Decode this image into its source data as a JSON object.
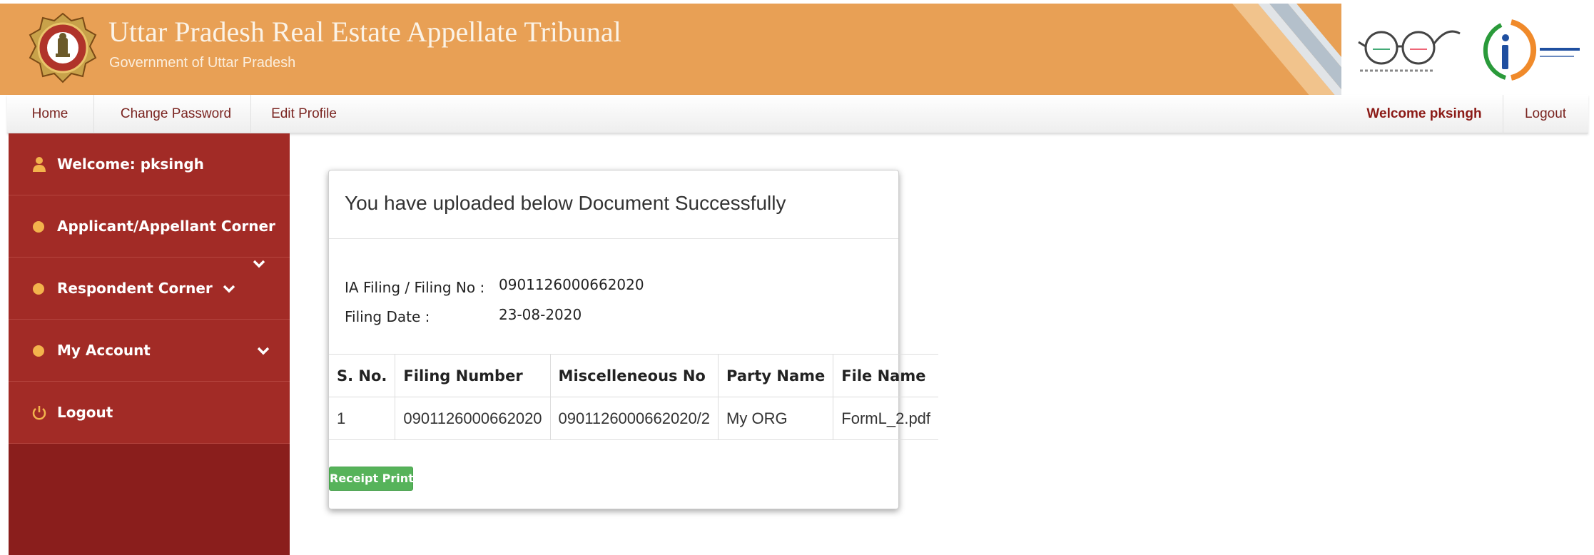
{
  "header": {
    "title": "Uttar Pradesh Real Estate Appellate Tribunal",
    "subtitle": "Government of Uttar Pradesh",
    "emblem_icon": "state-emblem-icon",
    "logos": [
      "swachh-bharat-logo",
      "digital-india-logo"
    ],
    "banner_color": "#e8a055"
  },
  "topnav": {
    "home": "Home",
    "change_password": "Change Password",
    "edit_profile": "Edit Profile",
    "welcome": "Welcome pksingh",
    "logout": "Logout"
  },
  "sidebar": {
    "items": [
      {
        "label": "Welcome: pksingh",
        "icon": "user-icon"
      },
      {
        "label": "Applicant/Appellant Corner",
        "icon": "circle-icon"
      },
      {
        "label": "Respondent Corner",
        "icon": "circle-icon"
      },
      {
        "label": "My Account",
        "icon": "circle-icon"
      },
      {
        "label": "Logout",
        "icon": "power-icon"
      }
    ],
    "color": "#a22b26"
  },
  "card": {
    "title": "You have uploaded below Document Successfully",
    "filing_no_label": "IA Filing / Filing No :",
    "filing_no_value": "0901126000662020",
    "filing_date_label": "Filing Date :",
    "filing_date_value": "23-08-2020",
    "table": {
      "headers": [
        "S. No.",
        "Filing Number",
        "Miscelleneous No",
        "Party Name",
        "File Name"
      ],
      "rows": [
        [
          "1",
          "0901126000662020",
          "0901126000662020/2",
          "My ORG",
          "FormL_2.pdf"
        ]
      ]
    },
    "receipt_button": "Receipt Print"
  }
}
